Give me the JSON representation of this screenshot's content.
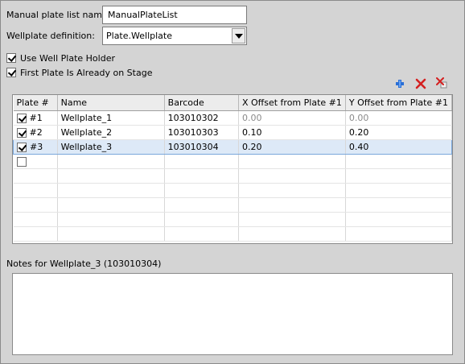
{
  "form": {
    "list_name_label": "Manual plate list name:",
    "list_name_value": "ManualPlateList",
    "wellplate_def_label": "Wellplate definition:",
    "wellplate_def_value": "Plate.Wellplate",
    "use_holder_label": "Use Well Plate Holder",
    "use_holder_checked": true,
    "first_plate_label": "First Plate Is Already on Stage",
    "first_plate_checked": true
  },
  "toolbar": {
    "add_icon": "add-icon",
    "delete_icon": "delete-icon",
    "delete_all_icon": "delete-all-icon"
  },
  "table": {
    "headers": [
      "Plate #",
      "Name",
      "Barcode",
      "X Offset from Plate #1",
      "Y Offset from Plate #1"
    ],
    "rows": [
      {
        "checked": true,
        "plate": "#1",
        "name": "Wellplate_1",
        "barcode": "103010302",
        "x": "0.00",
        "y": "0.00"
      },
      {
        "checked": true,
        "plate": "#2",
        "name": "Wellplate_2",
        "barcode": "103010303",
        "x": "0.10",
        "y": "0.20"
      },
      {
        "checked": true,
        "plate": "#3",
        "name": "Wellplate_3",
        "barcode": "103010304",
        "x": "0.20",
        "y": "0.40"
      }
    ],
    "selected_row": 2
  },
  "notes": {
    "label": "Notes for Wellplate_3 (103010304)",
    "value": ""
  },
  "colors": {
    "add": "#2a6fd6",
    "delete": "#d42020"
  }
}
